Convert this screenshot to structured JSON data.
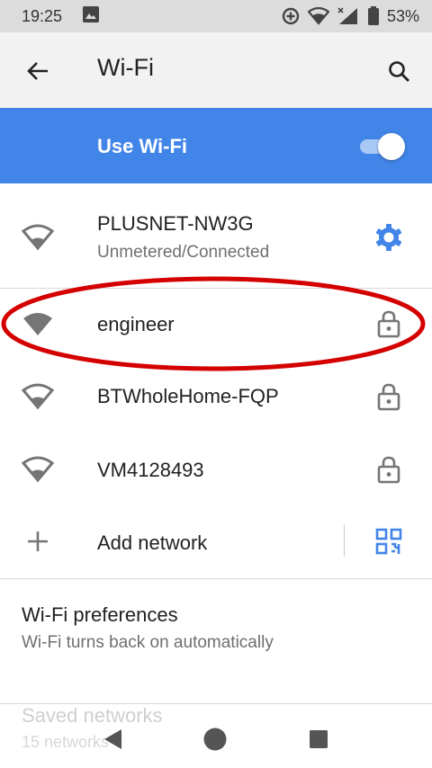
{
  "status_bar": {
    "time": "19:25",
    "battery": "53%",
    "icons": [
      "image-icon",
      "data-saver-icon",
      "wifi-icon",
      "cell-signal-icon",
      "battery-icon"
    ]
  },
  "app_bar": {
    "title": "Wi-Fi",
    "back_icon": "arrow-back-icon",
    "search_icon": "search-icon"
  },
  "master_switch": {
    "label": "Use Wi-Fi",
    "enabled": true
  },
  "networks": [
    {
      "ssid": "PLUSNET-NW3G",
      "status": "Unmetered/Connected",
      "signal_icon": "wifi-outline-icon",
      "trailing_icon": "gear-icon"
    },
    {
      "ssid": "engineer",
      "status": "",
      "signal_icon": "wifi-filled-icon",
      "trailing_icon": "lock-icon"
    },
    {
      "ssid": "BTWholeHome-FQP",
      "status": "",
      "signal_icon": "wifi-outline-icon",
      "trailing_icon": "lock-icon"
    },
    {
      "ssid": "VM4128493",
      "status": "",
      "signal_icon": "wifi-outline-icon",
      "trailing_icon": "lock-icon"
    }
  ],
  "add_network": {
    "label": "Add network",
    "icon": "plus-icon",
    "trailing_icon": "qr-code-scan-icon"
  },
  "preferences": {
    "title": "Wi-Fi preferences",
    "subtitle": "Wi-Fi turns back on automatically"
  },
  "saved_networks": {
    "title": "Saved networks",
    "subtitle": "15 networks"
  },
  "nav_bar": {
    "icons": [
      "back-triangle-icon",
      "home-circle-icon",
      "recents-square-icon"
    ]
  },
  "colors": {
    "accent": "#4285e8",
    "annotation": "#d40000",
    "status_bar_bg": "#dcdcdc",
    "app_bar_bg": "#f2f2f2"
  }
}
